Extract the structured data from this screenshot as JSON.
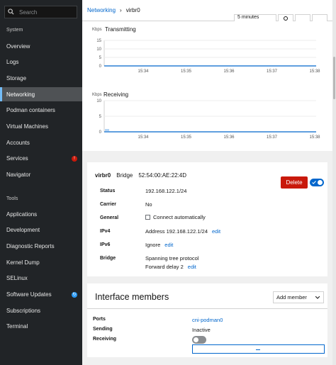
{
  "sidebar": {
    "search_placeholder": "Search",
    "system_heading": "System",
    "system_items": [
      {
        "label": "Overview"
      },
      {
        "label": "Logs"
      },
      {
        "label": "Storage"
      },
      {
        "label": "Networking",
        "active": true
      },
      {
        "label": "Podman containers"
      },
      {
        "label": "Virtual Machines"
      },
      {
        "label": "Accounts"
      },
      {
        "label": "Services",
        "badge": "!",
        "badge_color": "#c9190b"
      },
      {
        "label": "Navigator"
      }
    ],
    "tools_heading": "Tools",
    "tools_items": [
      {
        "label": "Applications"
      },
      {
        "label": "Development"
      },
      {
        "label": "Diagnostic Reports"
      },
      {
        "label": "Kernel Dump"
      },
      {
        "label": "SELinux"
      },
      {
        "label": "Software Updates",
        "badge": "↻",
        "badge_color": "#2b9af3"
      },
      {
        "label": "Subscriptions"
      },
      {
        "label": "Terminal"
      }
    ]
  },
  "breadcrumb": {
    "parent": "Networking",
    "separator": "›",
    "current": "virbr0"
  },
  "time_range": "5 minutes",
  "charts": [
    {
      "title": "Transmitting",
      "unit": "Kbps",
      "y_ticks": [
        "15",
        "10",
        "5",
        "0"
      ],
      "x_ticks": [
        "15:34",
        "15:35",
        "15:36",
        "15:37",
        "15:38"
      ]
    },
    {
      "title": "Receiving",
      "unit": "Kbps",
      "y_ticks": [
        "10",
        "5",
        "0"
      ],
      "x_ticks": [
        "15:34",
        "15:35",
        "15:36",
        "15:37",
        "15:38"
      ]
    }
  ],
  "chart_data": [
    {
      "type": "area",
      "title": "Transmitting",
      "ylabel": "Kbps",
      "x": [
        "15:34",
        "15:35",
        "15:36",
        "15:37",
        "15:38"
      ],
      "series": [
        {
          "values": [
            0,
            0,
            0,
            0,
            0
          ]
        }
      ],
      "ylim": [
        0,
        15
      ]
    },
    {
      "type": "area",
      "title": "Receiving",
      "ylabel": "Kbps",
      "x": [
        "15:34",
        "15:35",
        "15:36",
        "15:37",
        "15:38"
      ],
      "series": [
        {
          "values": [
            0,
            0,
            0,
            0,
            0
          ]
        }
      ],
      "ylim": [
        0,
        10
      ]
    }
  ],
  "interface": {
    "name": "virbr0",
    "type": "Bridge",
    "mac": "52:54:00:AE:22:4D",
    "delete_label": "Delete",
    "enabled": true,
    "rows": {
      "status_label": "Status",
      "status_value": "192.168.122.1/24",
      "carrier_label": "Carrier",
      "carrier_value": "No",
      "general_label": "General",
      "general_value": "Connect automatically",
      "ipv4_label": "IPv4",
      "ipv4_value": "Address 192.168.122.1/24",
      "ipv4_edit": "edit",
      "ipv6_label": "IPv6",
      "ipv6_value": "Ignore",
      "ipv6_edit": "edit",
      "bridge_label": "Bridge",
      "bridge_value1": "Spanning tree protocol",
      "bridge_value2": "Forward delay 2",
      "bridge_edit": "edit"
    }
  },
  "members": {
    "title": "Interface members",
    "add_label": "Add member",
    "ports_label": "Ports",
    "ports_value": "cni-podman0",
    "sending_label": "Sending",
    "sending_value": "Inactive",
    "receiving_label": "Receiving"
  },
  "colors": {
    "accent": "#0066cc",
    "danger": "#c9190b",
    "sidebar_bg": "#212427",
    "chart_line": "#0066cc"
  }
}
